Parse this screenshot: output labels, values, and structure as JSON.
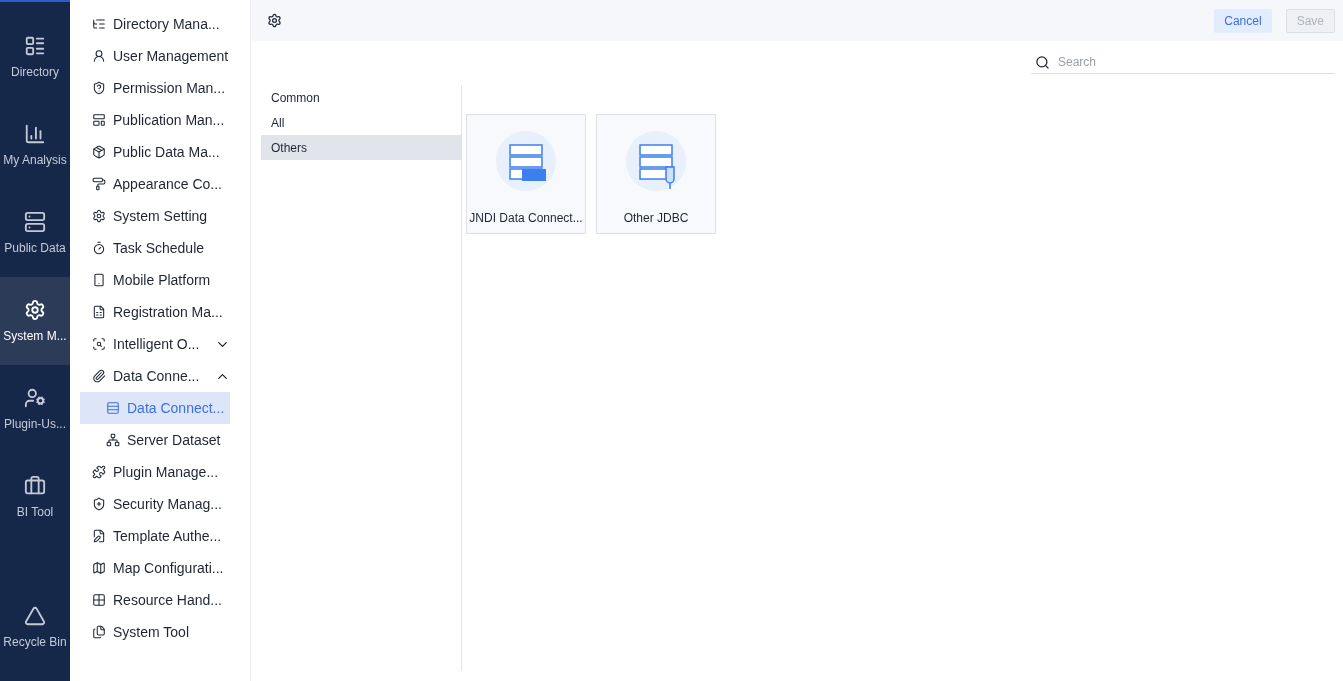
{
  "rail": [
    {
      "label": "Directory",
      "selected": false
    },
    {
      "label": "My Analysis",
      "selected": false
    },
    {
      "label": "Public Data",
      "selected": false
    },
    {
      "label": "System M...",
      "selected": true
    },
    {
      "label": "Plugin-Us...",
      "selected": false
    },
    {
      "label": "BI Tool",
      "selected": false
    },
    {
      "label": "Recycle Bin",
      "selected": false
    }
  ],
  "menu": [
    {
      "label": "Directory Mana...",
      "selected": false
    },
    {
      "label": "User Management",
      "selected": false
    },
    {
      "label": "Permission Man...",
      "selected": false
    },
    {
      "label": "Publication Man...",
      "selected": false
    },
    {
      "label": "Public Data Ma...",
      "selected": false
    },
    {
      "label": "Appearance Co...",
      "selected": false
    },
    {
      "label": "System Setting",
      "selected": false
    },
    {
      "label": "Task Schedule",
      "selected": false
    },
    {
      "label": "Mobile Platform",
      "selected": false
    },
    {
      "label": "Registration Ma...",
      "selected": false
    },
    {
      "label": "Intelligent O...",
      "selected": false,
      "expanded": false
    },
    {
      "label": "Data Conne...",
      "selected": false,
      "expanded": true,
      "children": [
        {
          "label": "Data Connect...",
          "selected": true
        },
        {
          "label": "Server Dataset",
          "selected": false
        }
      ]
    },
    {
      "label": "Plugin Manage...",
      "selected": false
    },
    {
      "label": "Security Manag...",
      "selected": false
    },
    {
      "label": "Template Authe...",
      "selected": false
    },
    {
      "label": "Map Configurati...",
      "selected": false
    },
    {
      "label": "Resource Hand...",
      "selected": false
    },
    {
      "label": "System Tool",
      "selected": false
    }
  ],
  "toolbar": {
    "cancel": "Cancel",
    "save": {
      "label": "Save",
      "disabled": true
    }
  },
  "search": {
    "placeholder": "Search"
  },
  "categories": [
    {
      "label": "Common",
      "selected": false
    },
    {
      "label": "All",
      "selected": false
    },
    {
      "label": "Others",
      "selected": true
    }
  ],
  "cards": [
    {
      "label": "JNDI Data Connect...",
      "kind": "jndi"
    },
    {
      "label": "Other JDBC",
      "kind": "jdbc"
    }
  ]
}
